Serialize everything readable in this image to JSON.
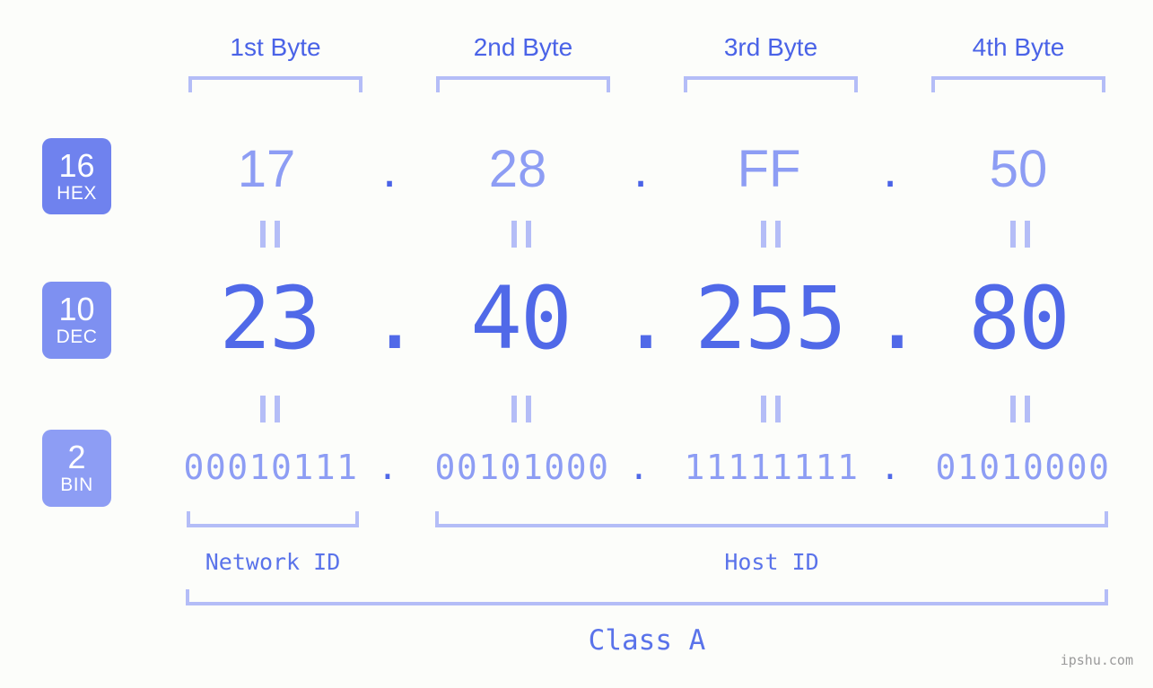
{
  "page": {
    "title": "IP Address Byte Breakdown",
    "background_color": "#fcfdfa",
    "watermark": "ipshu.com"
  },
  "colors": {
    "accent_strong": "#4a63e7",
    "accent_mid": "#5069e8",
    "accent_light": "#8d9df4",
    "bracket": "#b4bdf7",
    "badge_hex": "#6f82ee",
    "badge_dec": "#7e90f1",
    "badge_bin": "#8d9df4",
    "watermark_gray": "#9a9a9a"
  },
  "byte_headers": [
    {
      "label": "1st Byte"
    },
    {
      "label": "2nd Byte"
    },
    {
      "label": "3rd Byte"
    },
    {
      "label": "4th Byte"
    }
  ],
  "radix_badges": [
    {
      "number": "16",
      "name": "HEX"
    },
    {
      "number": "10",
      "name": "DEC"
    },
    {
      "number": "2",
      "name": "BIN"
    }
  ],
  "separator": ".",
  "equals_glyph": "=",
  "rows": {
    "hex": {
      "radix": 16,
      "badge_number": "16",
      "badge_name": "HEX",
      "values": [
        "17",
        "28",
        "FF",
        "50"
      ],
      "joined": "17.28.FF.50"
    },
    "dec": {
      "radix": 10,
      "badge_number": "10",
      "badge_name": "DEC",
      "values": [
        "23",
        "40",
        "255",
        "80"
      ],
      "joined": "23.40.255.80"
    },
    "bin": {
      "radix": 2,
      "badge_number": "2",
      "badge_name": "BIN",
      "values": [
        "00010111",
        "00101000",
        "11111111",
        "01010000"
      ],
      "joined": "00010111.00101000.11111111.01010000"
    }
  },
  "segments": {
    "network_id": {
      "label": "Network ID"
    },
    "host_id": {
      "label": "Host ID"
    },
    "class": {
      "label": "Class A"
    }
  }
}
